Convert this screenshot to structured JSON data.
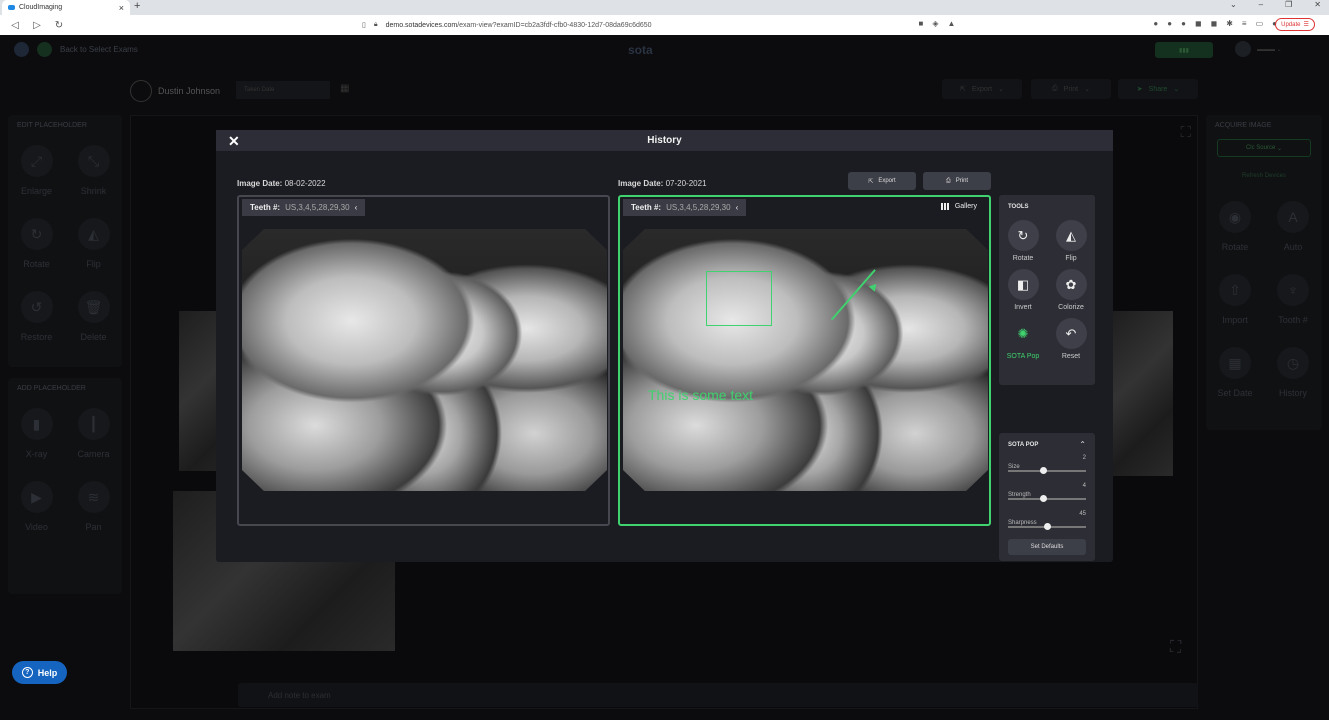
{
  "browser": {
    "tab_title": "CloudImaging",
    "new_tab": "+",
    "url_host": "demo.sotadevices.com",
    "url_path": "/exam-view?examID=cb2a3fdf-cfb0-4830-12d7-08da69c6d650",
    "update_label": "Update"
  },
  "app": {
    "back_label": "Back to Select Exams",
    "logo": "sota",
    "patient_name": "Dustin Johnson",
    "taken_date_label": "Taken Date",
    "export_label": "Export",
    "print_label": "Print",
    "share_label": "Share",
    "left_panel": {
      "title": "EDIT PLACEHOLDER",
      "items": [
        "Enlarge",
        "Shrink",
        "Rotate",
        "Flip",
        "Restore",
        "Delete"
      ]
    },
    "left_panel2": {
      "title": "ADD PLACEHOLDER",
      "items": [
        "X-ray",
        "Camera",
        "Video",
        "Pan"
      ]
    },
    "right_panel": {
      "title": "ACQUIRE IMAGE",
      "source": "Clc Source",
      "refresh": "Refresh Devices",
      "items": [
        "Rotate",
        "Auto",
        "Import",
        "Tooth #",
        "Set Date",
        "History"
      ]
    },
    "note_placeholder": "Add note to exam",
    "help_label": "Help"
  },
  "modal": {
    "title": "History",
    "left": {
      "date_label": "Image Date:",
      "date_value": "08-02-2022",
      "teeth_label": "Teeth #:",
      "teeth_value": "US,3,4,5,28,29,30"
    },
    "right": {
      "date_label": "Image Date:",
      "date_value": "07-20-2021",
      "teeth_label": "Teeth #:",
      "teeth_value": "US,3,4,5,28,29,30",
      "gallery_label": "Gallery",
      "annotation_text": "This is some text"
    },
    "export_label": "Export",
    "print_label": "Print",
    "tools": {
      "title": "TOOLS",
      "items": [
        "Rotate",
        "Flip",
        "Invert",
        "Colorize",
        "SOTA Pop",
        "Reset"
      ]
    },
    "sota_pop": {
      "title": "SOTA POP",
      "sliders": [
        {
          "name": "Size",
          "value": 2,
          "fraction": 0.45
        },
        {
          "name": "Strength",
          "value": 4,
          "fraction": 0.45
        },
        {
          "name": "Sharpness",
          "value": 45,
          "fraction": 0.5
        }
      ],
      "defaults_label": "Set Defaults"
    }
  },
  "colors": {
    "accent": "#3fd26e",
    "help": "#1565c0"
  }
}
